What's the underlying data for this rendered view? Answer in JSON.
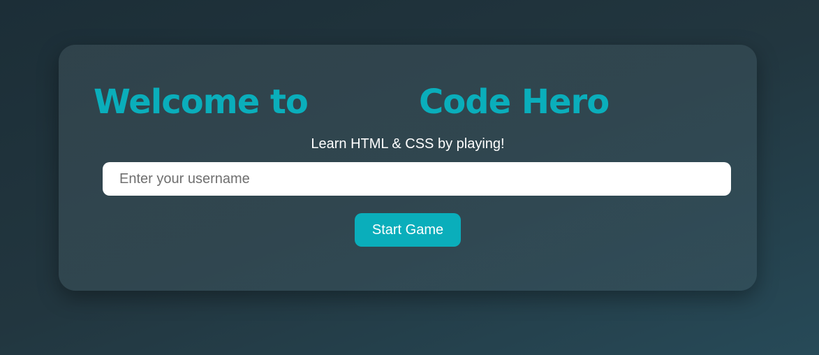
{
  "welcome": {
    "title_part1": "Welcome to",
    "title_part2": "Code Hero",
    "subtitle": "Learn HTML & CSS by playing!",
    "username_placeholder": "Enter your username",
    "start_button_label": "Start Game"
  },
  "colors": {
    "accent": "#0aaebb",
    "background": "#22363f",
    "card": "#3a545f",
    "input_background": "#ffffff"
  }
}
